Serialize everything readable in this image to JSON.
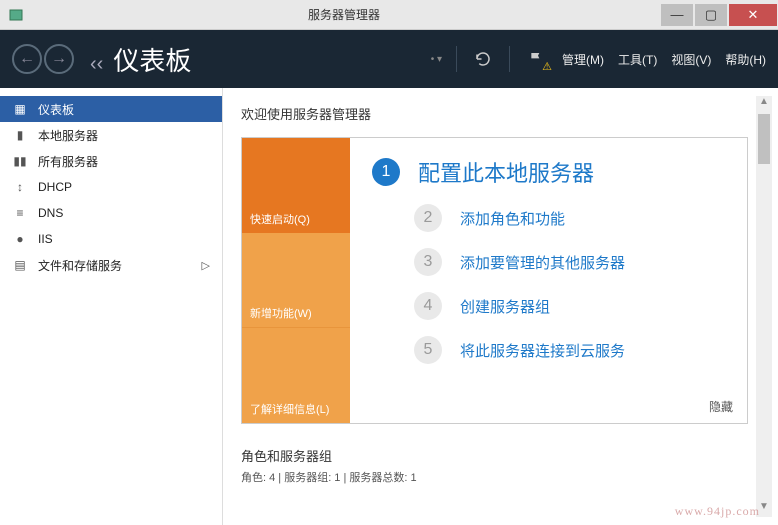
{
  "window": {
    "title": "服务器管理器",
    "buttons": {
      "min": "—",
      "max": "▢",
      "close": "✕"
    }
  },
  "toolbar": {
    "breadcrumb_title": "仪表板",
    "menus": {
      "manage": "管理(M)",
      "tools": "工具(T)",
      "view": "视图(V)",
      "help": "帮助(H)"
    }
  },
  "sidebar": {
    "items": [
      {
        "icon": "dashboard",
        "label": "仪表板",
        "selected": true
      },
      {
        "icon": "server",
        "label": "本地服务器"
      },
      {
        "icon": "servers",
        "label": "所有服务器"
      },
      {
        "icon": "dhcp",
        "label": "DHCP"
      },
      {
        "icon": "dns",
        "label": "DNS"
      },
      {
        "icon": "iis",
        "label": "IIS"
      },
      {
        "icon": "storage",
        "label": "文件和存储服务",
        "expandable": true
      }
    ]
  },
  "content": {
    "welcome_header": "欢迎使用服务器管理器",
    "tiles": {
      "quick_start": "快速启动(Q)",
      "whats_new": "新增功能(W)",
      "learn_more": "了解详细信息(L)"
    },
    "steps": [
      {
        "num": "1",
        "text": "配置此本地服务器",
        "primary": true
      },
      {
        "num": "2",
        "text": "添加角色和功能"
      },
      {
        "num": "3",
        "text": "添加要管理的其他服务器"
      },
      {
        "num": "4",
        "text": "创建服务器组"
      },
      {
        "num": "5",
        "text": "将此服务器连接到云服务"
      }
    ],
    "hide": "隐藏",
    "roles": {
      "title": "角色和服务器组",
      "subtitle": "角色: 4 | 服务器组: 1 | 服务器总数: 1"
    }
  },
  "watermark": "www.94jp.com"
}
